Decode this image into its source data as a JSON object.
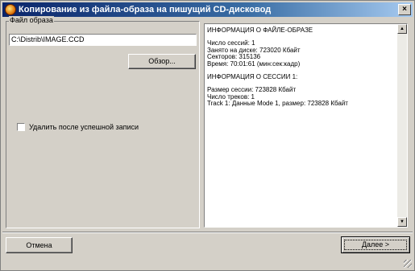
{
  "window": {
    "title": "Копирование из файла-образа на пишущий CD-дисковод",
    "close_glyph": "×"
  },
  "left": {
    "group_label": "Файл образа",
    "path_value": "C:\\Distrib\\IMAGE.CCD",
    "browse_label": "Обзор...",
    "checkbox_label": "Удалить после успешной записи",
    "checkbox_checked": false
  },
  "info": {
    "lines": [
      "ИНФОРМАЦИЯ О ФАЙЛЕ-ОБРАЗЕ",
      "",
      "Число сессий: 1",
      "Занято на диске: 723020 Кбайт",
      "Секторов: 315136",
      "Время: 70:01:61 (мин:сек:кадр)",
      "",
      "ИНФОРМАЦИЯ О СЕССИИ 1:",
      "",
      "Размер сессии: 723828 Кбайт",
      "Число треков: 1",
      " Track 1: Данные Mode 1, размер: 723828 Кбайт"
    ]
  },
  "buttons": {
    "cancel_label": "Отмена",
    "next_label": "Далее >"
  },
  "scrollbar": {
    "up_glyph": "▲",
    "down_glyph": "▼"
  }
}
